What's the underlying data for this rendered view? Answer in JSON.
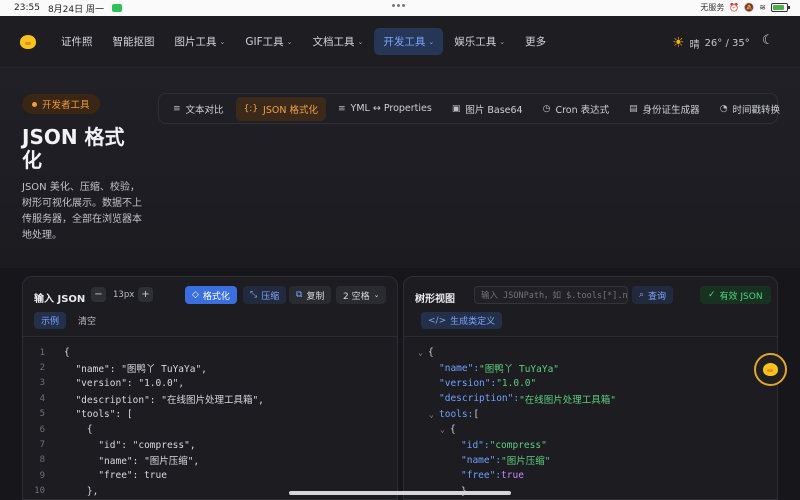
{
  "status_bar": {
    "time": "23:55",
    "date": "8月24日 周一",
    "right_info": "无服务"
  },
  "nav": {
    "items": [
      {
        "label": "证件照",
        "caret": false
      },
      {
        "label": "智能抠图",
        "caret": false
      },
      {
        "label": "图片工具",
        "caret": true
      },
      {
        "label": "GIF工具",
        "caret": true
      },
      {
        "label": "文档工具",
        "caret": true
      },
      {
        "label": "开发工具",
        "caret": true,
        "active": true
      },
      {
        "label": "娱乐工具",
        "caret": true
      },
      {
        "label": "更多",
        "caret": false
      }
    ],
    "weather_text": "晴",
    "weather_temp": "26° / 35°"
  },
  "hero": {
    "badge": "开发者工具",
    "title": "JSON 格式化",
    "description": "JSON 美化、压缩、校验，树形可视化展示。数据不上传服务器，全部在浏览器本地处理。"
  },
  "tools": [
    {
      "label": "文本对比",
      "icon": "≡"
    },
    {
      "label": "JSON 格式化",
      "icon": "{:}",
      "active": true
    },
    {
      "label": "YML ↔ Properties",
      "icon": "≡"
    },
    {
      "label": "图片 Base64",
      "icon": "▣"
    },
    {
      "label": "Cron 表达式",
      "icon": "◷"
    },
    {
      "label": "身份证生成器",
      "icon": "▤"
    },
    {
      "label": "时间戳转换",
      "icon": "◔"
    }
  ],
  "input_panel": {
    "title": "输入 JSON",
    "font_size": "13px",
    "format_btn": "格式化",
    "compress_btn": "压缩",
    "copy_btn": "复制",
    "indent_select": "2 空格",
    "example_btn": "示例",
    "clear_btn": "清空",
    "code_lines": [
      "{",
      "  \"name\": \"图鸭丫 TuYaYa\",",
      "  \"version\": \"1.0.0\",",
      "  \"description\": \"在线图片处理工具箱\",",
      "  \"tools\": [",
      "    {",
      "      \"id\": \"compress\",",
      "      \"name\": \"图片压缩\",",
      "      \"free\": true",
      "    },"
    ],
    "line_numbers": [
      "1",
      "2",
      "3",
      "4",
      "5",
      "6",
      "7",
      "8",
      "9",
      "10"
    ]
  },
  "tree_panel": {
    "title": "树形视图",
    "search_placeholder": "输入 JSONPath，如 $.tools[*].name",
    "query_btn": "查询",
    "valid_badge": "有效 JSON",
    "gen_class_btn": "生成类定义",
    "rows": [
      {
        "key": "",
        "value": "",
        "open": "{",
        "indent": 0,
        "caret": true
      },
      {
        "key": "\"name\":",
        "value": "\"图鸭丫 TuYaYa\"",
        "type": "str",
        "indent": 1
      },
      {
        "key": "\"version\":",
        "value": "\"1.0.0\"",
        "type": "str",
        "indent": 1
      },
      {
        "key": "\"description\":",
        "value": "\"在线图片处理工具箱\"",
        "type": "str",
        "indent": 1
      },
      {
        "key": "tools:",
        "value": "",
        "open": "[",
        "indent": 1,
        "caret": true
      },
      {
        "key": "",
        "value": "",
        "open": "{",
        "indent": 2,
        "caret": true
      },
      {
        "key": "\"id\":",
        "value": "\"compress\"",
        "type": "str",
        "indent": 3
      },
      {
        "key": "\"name\":",
        "value": "\"图片压缩\"",
        "type": "str",
        "indent": 3
      },
      {
        "key": "\"free\":",
        "value": "true",
        "type": "bool",
        "indent": 3
      },
      {
        "key": "",
        "value": "",
        "open": "}",
        "indent": 3
      }
    ]
  },
  "colors": {
    "accent": "#3b6fe0",
    "orange": "#f0a04a",
    "green": "#4fd27e"
  }
}
